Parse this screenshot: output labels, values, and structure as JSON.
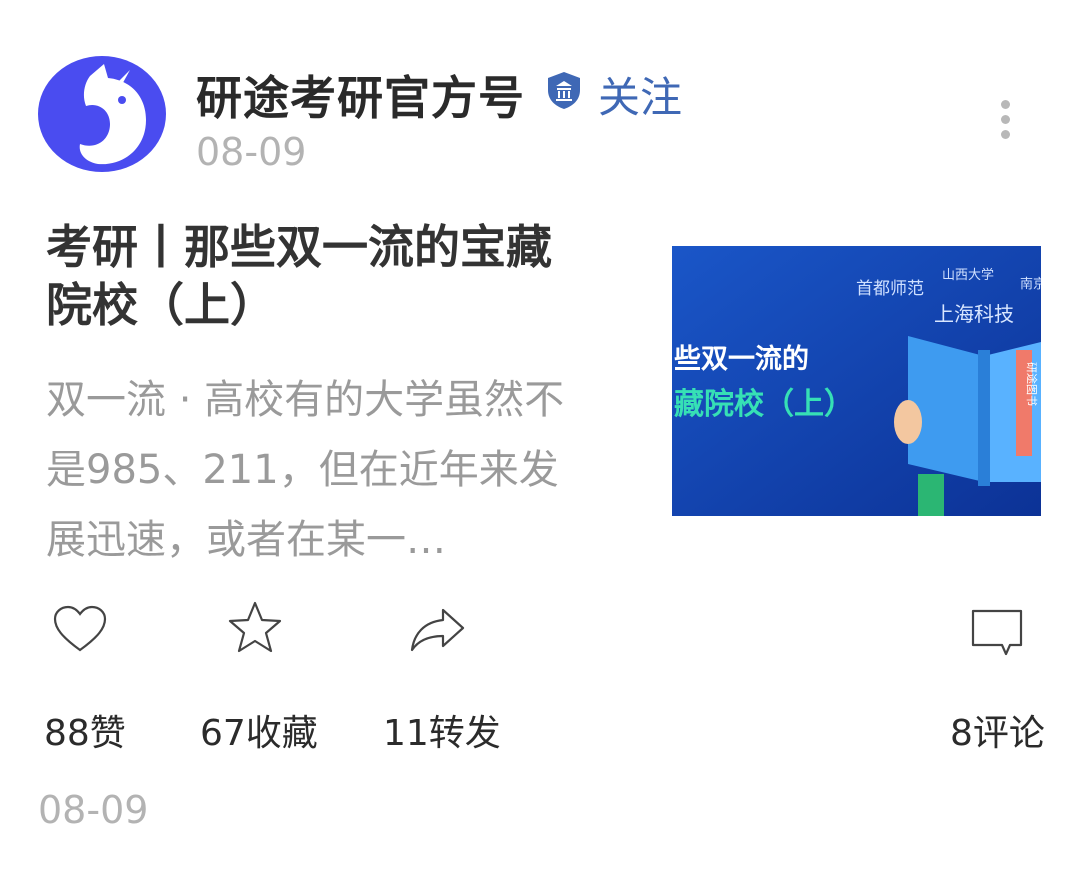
{
  "header": {
    "account_name": "研途考研官方号",
    "follow_label": "关注",
    "date": "08-09",
    "avatar_icon": "unicorn-logo",
    "verified_icon": "shield-bank-icon",
    "more_icon": "more-vertical-icon"
  },
  "article": {
    "title": "考研丨那些双一流的宝藏院校（上）",
    "summary": "双一流 · 高校有的大学虽然不是985、211，但在近年来发展迅速，或者在某一…",
    "thumbnail": {
      "headline_line1": "些双一流的",
      "headline_line2": "藏院校（上）",
      "school_1": "首都师范",
      "school_2": "山西大学",
      "school_3": "南京",
      "school_4": "上海科技",
      "book_spine": "研途图书"
    }
  },
  "actions": {
    "like_label": "88赞",
    "favorite_label": "67收藏",
    "share_label": "11转发",
    "comment_label": "8评论"
  },
  "footer": {
    "date": "08-09"
  },
  "colors": {
    "accent": "#3f68b5",
    "brand_purple": "#4a4cf0",
    "muted": "#b3b3b3"
  }
}
